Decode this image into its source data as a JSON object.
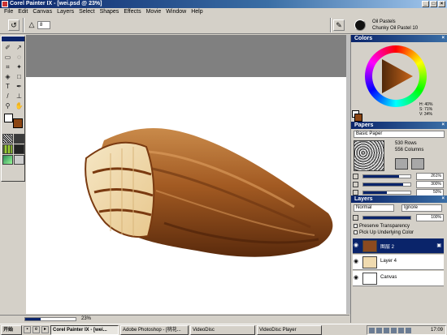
{
  "window": {
    "title": "Corel Painter IX - [wei.psd @ 23%]"
  },
  "menu": [
    "File",
    "Edit",
    "Canvas",
    "Layers",
    "Select",
    "Shapes",
    "Effects",
    "Movie",
    "Window",
    "Help"
  ],
  "propbar": {
    "field_value": "8"
  },
  "brush": {
    "category": "Oil Pastels",
    "variant": "Chunky Oil Pastel 10"
  },
  "toolbox": {
    "tools": [
      "brush-icon",
      "dropper-icon",
      "rect-select-icon",
      "lasso-icon",
      "crop-icon",
      "magic-wand-icon",
      "paint-bucket-icon",
      "shape-icon",
      "text-icon",
      "pen-icon",
      "smudge-icon",
      "rubber-stamp-icon",
      "magnifier-icon",
      "grabber-icon"
    ],
    "main_color": "#ffffff",
    "additional_color": "#8b4513"
  },
  "colors_palette": {
    "title": "Colors",
    "H": "H: 40%",
    "S": "S: 71%",
    "V": "V: 34%"
  },
  "papers_palette": {
    "title": "Papers",
    "paper_name": "Basic Paper",
    "rows": "530 Rows",
    "columns": "556 Columns",
    "rows_values": [
      {
        "label": "261%",
        "fill": 0.75
      },
      {
        "label": "300%",
        "fill": 0.85
      },
      {
        "label": "50%",
        "fill": 0.5
      }
    ]
  },
  "layers_palette": {
    "title": "Layers",
    "composite_method": "Normal",
    "composite_depth": "Ignore",
    "opacity": "100%",
    "preserve_transparency": "Preserve Transparency",
    "pick_up_color": "Pick Up Underlying Color",
    "layers": [
      {
        "name": "图层 2",
        "selected": true
      },
      {
        "name": "Layer 4",
        "selected": false
      },
      {
        "name": "Canvas",
        "selected": false
      }
    ]
  },
  "zoom": {
    "value": "23%",
    "fill": 0.3
  },
  "taskbar": {
    "start": "开始",
    "tasks": [
      "Corel Painter IX - [wei...",
      "Adobe Photoshop - [桃花...",
      "VideoDisc",
      "VideoDisc Player"
    ],
    "clock": "17:09"
  }
}
